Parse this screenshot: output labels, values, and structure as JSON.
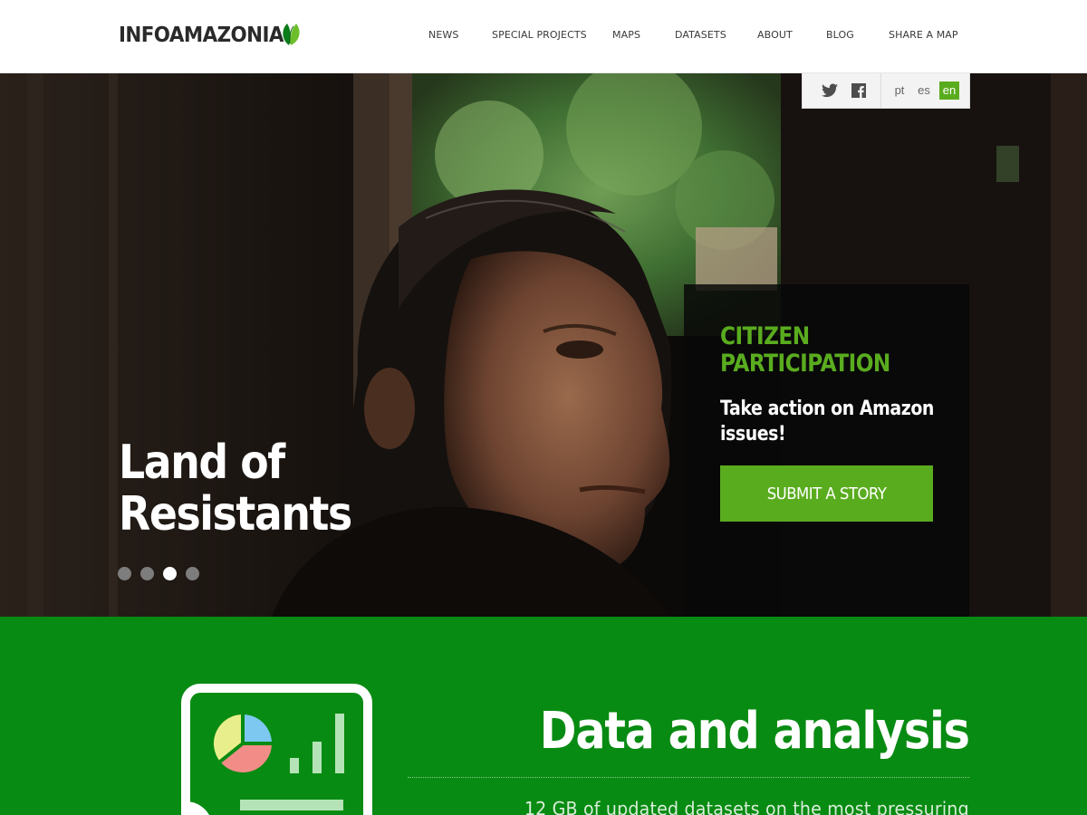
{
  "header": {
    "logo_text": "INFOAMAZONIA",
    "nav": [
      "NEWS",
      "SPECIAL PROJECTS",
      "MAPS",
      "DATASETS",
      "ABOUT",
      "BLOG",
      "SHARE A MAP"
    ]
  },
  "social": {
    "icons": [
      "twitter-icon",
      "facebook-icon"
    ],
    "languages": [
      "pt",
      "es",
      "en"
    ],
    "active_language": "en"
  },
  "hero": {
    "title": "Land of\nResistants",
    "slides_count": 4,
    "active_slide": 3
  },
  "cta": {
    "kicker": "CITIZEN\nPARTICIPATION",
    "text": "Take action on Amazon\nissues!",
    "button_label": "SUBMIT A STORY"
  },
  "data_section": {
    "title": "Data and analysis",
    "description": "12 GB of updated datasets on the most pressuring"
  },
  "colors": {
    "brand_green": "#5aac1f",
    "section_green": "#088b12",
    "header_text": "#3a3a3a"
  }
}
